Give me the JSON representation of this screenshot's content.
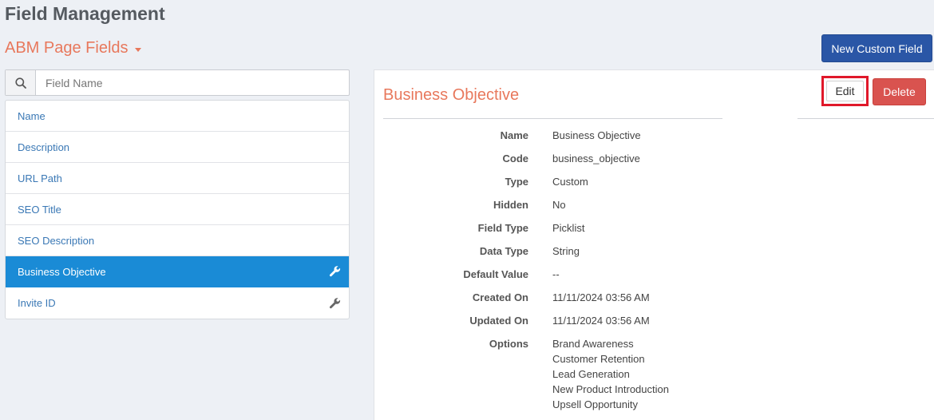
{
  "page": {
    "title": "Field Management"
  },
  "section": {
    "dropdown_label": "ABM Page Fields"
  },
  "toolbar": {
    "new_custom_field": "New Custom Field"
  },
  "search": {
    "placeholder": "Field Name",
    "icon": "search-icon"
  },
  "field_list": {
    "items": [
      {
        "label": "Name",
        "active": false,
        "has_wrench": false
      },
      {
        "label": "Description",
        "active": false,
        "has_wrench": false
      },
      {
        "label": "URL Path",
        "active": false,
        "has_wrench": false
      },
      {
        "label": "SEO Title",
        "active": false,
        "has_wrench": false
      },
      {
        "label": "SEO Description",
        "active": false,
        "has_wrench": false
      },
      {
        "label": "Business Objective",
        "active": true,
        "has_wrench": true
      },
      {
        "label": "Invite ID",
        "active": false,
        "has_wrench": true
      }
    ]
  },
  "detail": {
    "title": "Business Objective",
    "edit_label": "Edit",
    "delete_label": "Delete",
    "properties": [
      {
        "label": "Name",
        "value": "Business Objective"
      },
      {
        "label": "Code",
        "value": "business_objective"
      },
      {
        "label": "Type",
        "value": "Custom"
      },
      {
        "label": "Hidden",
        "value": "No"
      },
      {
        "label": "Field Type",
        "value": "Picklist"
      },
      {
        "label": "Data Type",
        "value": "String"
      },
      {
        "label": "Default Value",
        "value": "--"
      },
      {
        "label": "Created On",
        "value": "11/11/2024 03:56 AM"
      },
      {
        "label": "Updated On",
        "value": "11/11/2024 03:56 AM"
      }
    ],
    "options_label": "Options",
    "options": [
      "Brand Awareness",
      "Customer Retention",
      "Lead Generation",
      "New Product Introduction",
      "Upsell Opportunity"
    ]
  },
  "colors": {
    "accent_orange": "#e8785c",
    "primary_blue": "#2a56a6",
    "active_item": "#1a8bd6",
    "delete_red": "#d9534f",
    "highlight_box": "#e0182a"
  }
}
